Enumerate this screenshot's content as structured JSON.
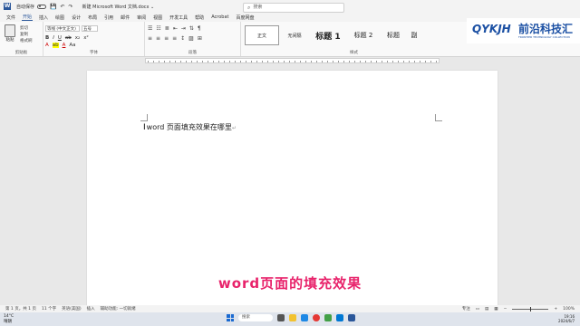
{
  "titlebar": {
    "autosave_label": "自动保存",
    "toggle_state": "关",
    "doc_title": "新建 Microsoft Word 文档.docx ⌄"
  },
  "search": {
    "placeholder": "搜索"
  },
  "tabs": [
    "文件",
    "开始",
    "插入",
    "绘图",
    "设计",
    "布局",
    "引用",
    "邮件",
    "审阅",
    "视图",
    "开发工具",
    "帮助",
    "Acrobat",
    "百度网盘"
  ],
  "active_tab": "开始",
  "ribbon": {
    "clipboard": {
      "paste_label": "粘贴",
      "cut_label": "剪切",
      "copy_label": "复制",
      "format_painter_label": "格式刷",
      "group_label": "剪贴板"
    },
    "font": {
      "font_name": "等线 (中文正文)",
      "font_size": "五号",
      "group_label": "字体"
    },
    "paragraph": {
      "group_label": "段落"
    },
    "styles": {
      "items": [
        "正文",
        "无间隔",
        "标题 1",
        "标题 2",
        "标题",
        "副"
      ],
      "group_label": "样式"
    }
  },
  "logo": {
    "brand": "QYKJH",
    "brand_cn": "前沿科技汇",
    "brand_en": "FRONTIER TECHNOLOGY COLLECTION"
  },
  "document": {
    "text": "word 页面填充效果在哪里"
  },
  "caption": "word页面的填充效果",
  "status": {
    "page": "第 1 页，共 1 页",
    "words": "11 个字",
    "language": "英语(美国)",
    "insert_mode": "插入",
    "accessibility": "辅助功能: 一切就绪",
    "focus": "专注",
    "zoom": "100%"
  },
  "taskbar": {
    "weather_temp": "14°C",
    "weather_desc": "晴朗",
    "search_label": "搜索",
    "time": "19:16",
    "date": "2024/6/7"
  },
  "colors": {
    "word_blue": "#2b579a",
    "logo_blue": "#1a4fa3",
    "caption_pink": "#e8236b"
  }
}
